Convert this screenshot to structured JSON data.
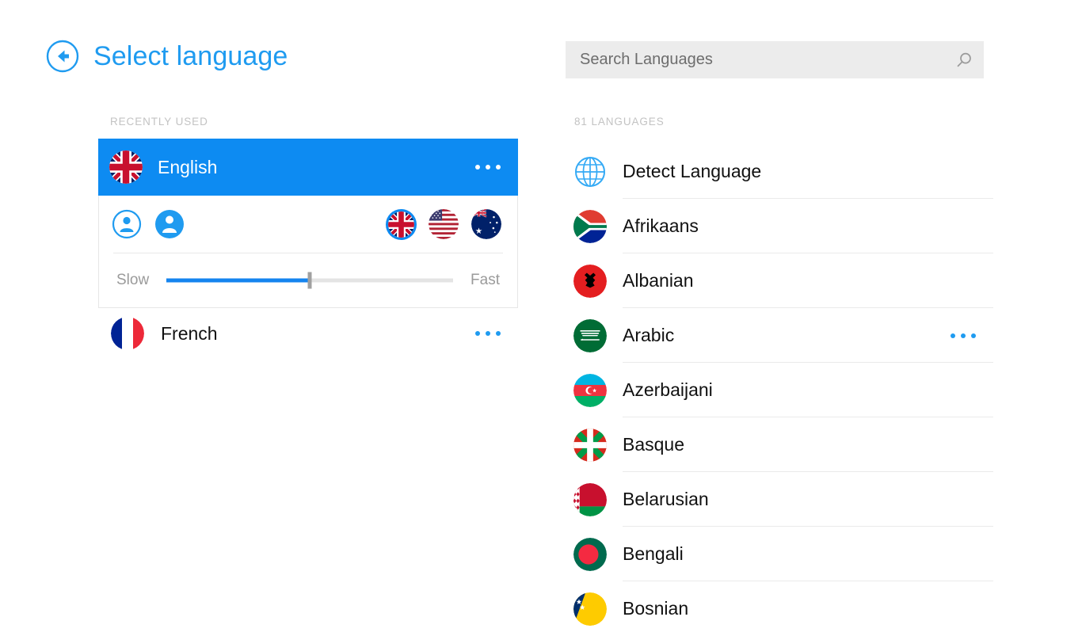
{
  "header": {
    "title": "Select language",
    "back_icon": "back-arrow-icon",
    "accent_color": "#1f9bf0"
  },
  "left": {
    "section_label": "RECENTLY USED",
    "recent": [
      {
        "name": "English",
        "flag": "gb",
        "selected": true,
        "expanded": true,
        "ellipsis": "…",
        "voices": [
          {
            "name": "male-voice",
            "selected": false
          },
          {
            "name": "female-voice",
            "selected": true
          }
        ],
        "accents": [
          {
            "flag": "gb",
            "label": "United Kingdom",
            "selected": true
          },
          {
            "flag": "us",
            "label": "United States",
            "selected": false
          },
          {
            "flag": "au",
            "label": "Australia",
            "selected": false
          }
        ],
        "speed": {
          "slow_label": "Slow",
          "fast_label": "Fast",
          "value": 50,
          "min": 0,
          "max": 100
        }
      },
      {
        "name": "French",
        "flag": "fr",
        "selected": false,
        "expanded": false,
        "ellipsis": "…"
      }
    ]
  },
  "right": {
    "search": {
      "placeholder": "Search Languages",
      "value": "",
      "icon": "search-icon"
    },
    "count_label": "81 LANGUAGES",
    "languages": [
      {
        "name": "Detect Language",
        "flag": "globe",
        "ellipsis": false
      },
      {
        "name": "Afrikaans",
        "flag": "za",
        "ellipsis": false
      },
      {
        "name": "Albanian",
        "flag": "al",
        "ellipsis": false
      },
      {
        "name": "Arabic",
        "flag": "sa",
        "ellipsis": true
      },
      {
        "name": "Azerbaijani",
        "flag": "az",
        "ellipsis": false
      },
      {
        "name": "Basque",
        "flag": "eus",
        "ellipsis": false
      },
      {
        "name": "Belarusian",
        "flag": "by",
        "ellipsis": false
      },
      {
        "name": "Bengali",
        "flag": "bd",
        "ellipsis": false
      },
      {
        "name": "Bosnian",
        "flag": "ba",
        "ellipsis": false
      }
    ]
  }
}
